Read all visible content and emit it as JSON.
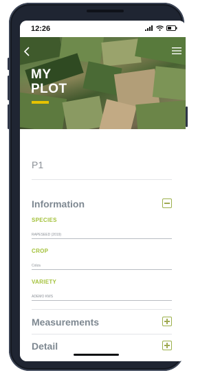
{
  "status_bar": {
    "time": "12:26"
  },
  "header": {
    "title": "MY\nPLOT"
  },
  "plot": {
    "name": "P1"
  },
  "sections": {
    "information": {
      "title": "Information",
      "fields": [
        {
          "label": "SPECIES",
          "value": "RAPESEED (2019)"
        },
        {
          "label": "CROP",
          "value": "Colza"
        },
        {
          "label": "VARIETY",
          "value": "ADEMO KWS"
        }
      ]
    },
    "measurements": {
      "title": "Measurements"
    },
    "detail": {
      "title": "Detail"
    }
  },
  "colors": {
    "accent_green": "#a3c13a",
    "accent_yellow": "#e6c200",
    "title_gray": "#7e8891"
  },
  "icons": [
    "back-icon",
    "menu-icon",
    "signal-icon",
    "wifi-icon",
    "battery-icon",
    "collapse-icon",
    "expand-icon"
  ]
}
